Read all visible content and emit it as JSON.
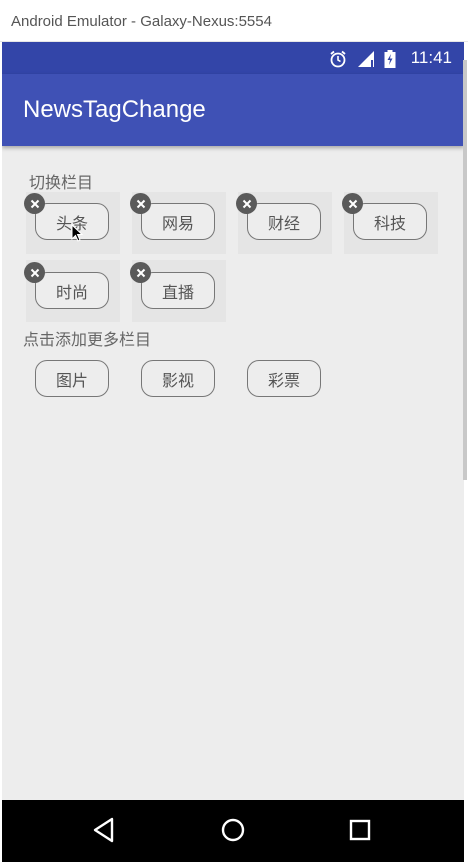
{
  "window": {
    "title": "Android Emulator - Galaxy-Nexus:5554"
  },
  "statusbar": {
    "time": "11:41",
    "icons": [
      "alarm-icon",
      "signal-icon",
      "battery-icon"
    ]
  },
  "appbar": {
    "title": "NewsTagChange"
  },
  "switch_section": {
    "label": "切换栏目",
    "tags": [
      {
        "label": "头条"
      },
      {
        "label": "网易"
      },
      {
        "label": "财经"
      },
      {
        "label": "科技"
      },
      {
        "label": "时尚"
      },
      {
        "label": "直播"
      }
    ]
  },
  "add_section": {
    "label": "点击添加更多栏目",
    "tags": [
      {
        "label": "图片"
      },
      {
        "label": "影视"
      },
      {
        "label": "彩票"
      }
    ]
  },
  "navbar": {
    "buttons": [
      "back-icon",
      "home-icon",
      "recents-icon"
    ]
  },
  "colors": {
    "statusbar": "#3345a8",
    "appbar": "#3f51b5",
    "background": "#ededed",
    "navbar": "#000000"
  }
}
